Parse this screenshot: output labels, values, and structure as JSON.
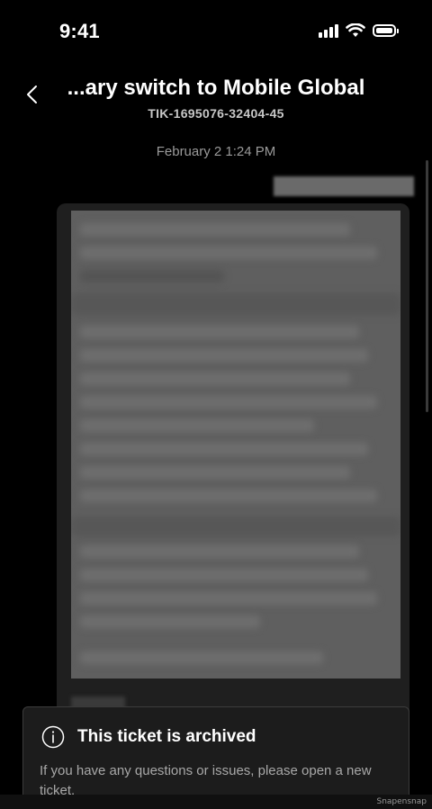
{
  "status_bar": {
    "time": "9:41",
    "icons": [
      "cellular-signal-icon",
      "wifi-icon",
      "battery-icon"
    ]
  },
  "header": {
    "back_icon": "chevron-left-icon",
    "title": "...ary switch to Mobile Global",
    "ticket_id": "TIK-1695076-32404-45"
  },
  "conversation": {
    "date": "February 2  1:24 PM",
    "message": {
      "content_redacted": true
    }
  },
  "archive_banner": {
    "icon": "info-icon",
    "title": "This ticket is archived",
    "body": "If you have any questions or issues, please open a new ticket."
  },
  "watermark": "Snapensnap",
  "colors": {
    "background": "#000000",
    "card": "#1f1f1f",
    "banner": "#1c1c1c",
    "text_secondary": "#a8a8a8"
  }
}
